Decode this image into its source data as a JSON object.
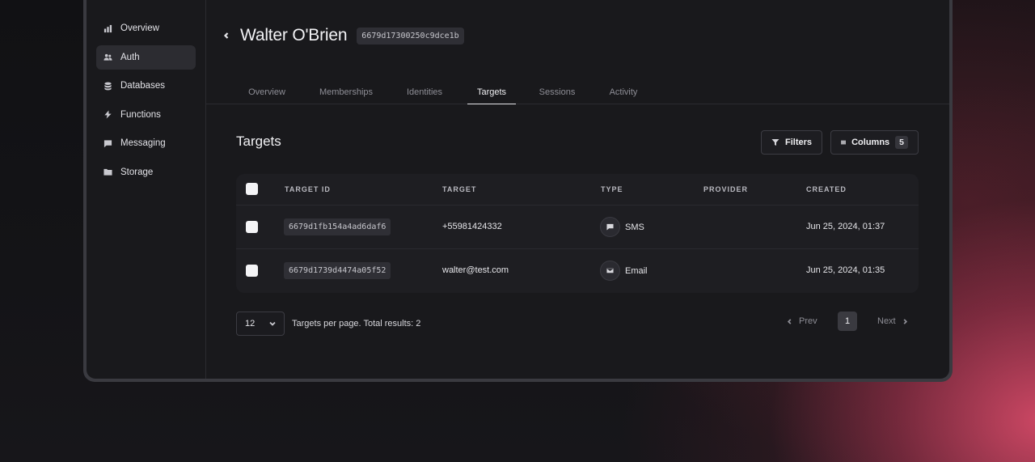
{
  "sidebar": {
    "items": [
      {
        "label": "Overview",
        "icon": "bar-chart-icon"
      },
      {
        "label": "Auth",
        "icon": "users-icon",
        "active": true
      },
      {
        "label": "Databases",
        "icon": "database-icon"
      },
      {
        "label": "Functions",
        "icon": "lightning-icon"
      },
      {
        "label": "Messaging",
        "icon": "message-icon"
      },
      {
        "label": "Storage",
        "icon": "folder-icon"
      }
    ]
  },
  "header": {
    "title": "Walter O'Brien",
    "user_id": "6679d17300250c9dce1b"
  },
  "tabs": [
    {
      "label": "Overview"
    },
    {
      "label": "Memberships"
    },
    {
      "label": "Identities"
    },
    {
      "label": "Targets",
      "active": true
    },
    {
      "label": "Sessions"
    },
    {
      "label": "Activity"
    }
  ],
  "section": {
    "title": "Targets",
    "filters_label": "Filters",
    "columns_label": "Columns",
    "columns_count": "5"
  },
  "table": {
    "headers": [
      "TARGET ID",
      "TARGET",
      "TYPE",
      "PROVIDER",
      "CREATED"
    ],
    "rows": [
      {
        "target_id": "6679d1fb154a4ad6daf6",
        "target": "+55981424332",
        "type": "SMS",
        "type_icon": "message-icon",
        "provider": "",
        "created": "Jun 25, 2024, 01:37"
      },
      {
        "target_id": "6679d1739d4474a05f52",
        "target": "walter@test.com",
        "type": "Email",
        "type_icon": "mail-icon",
        "provider": "",
        "created": "Jun 25, 2024, 01:35"
      }
    ]
  },
  "pagination": {
    "per_page": "12",
    "summary": "Targets per page. Total results: 2",
    "prev_label": "Prev",
    "next_label": "Next",
    "current_page": "1"
  },
  "colors": {
    "background": "#19191c",
    "accent": "#d64a68"
  }
}
